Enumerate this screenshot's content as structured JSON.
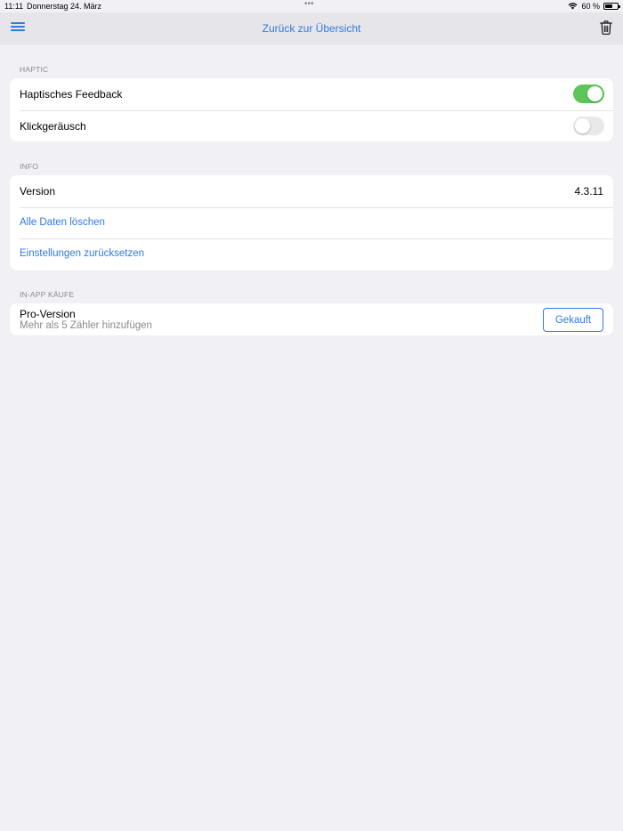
{
  "status_bar": {
    "time": "11:11",
    "date": "Donnerstag 24. März",
    "battery": "60 %",
    "battery_level": 0.6,
    "multitask_dots": "•••"
  },
  "nav": {
    "title": "Zurück zur Übersicht",
    "menu_icon": "hamburger-menu-icon",
    "trash_icon": "trash-icon",
    "accent": "#2f7ae5"
  },
  "sections": {
    "haptic": {
      "header": "HAPTIC",
      "rows": [
        {
          "label": "Haptisches Feedback",
          "toggle_on": true
        },
        {
          "label": "Klickgeräusch",
          "toggle_on": false
        }
      ]
    },
    "info": {
      "header": "INFO",
      "version_label": "Version",
      "version_value": "4.3.11",
      "delete_all": "Alle Daten löschen",
      "reset_settings": "Einstellungen zurücksetzen"
    },
    "iap": {
      "header": "IN-APP KÄUFE",
      "title": "Pro-Version",
      "subtitle": "Mehr als 5 Zähler hinzufügen",
      "button": "Gekauft"
    }
  },
  "colors": {
    "toggle_on": "#5cc65a",
    "background": "#f0f0f5",
    "nav_background": "#e5e5ea"
  }
}
